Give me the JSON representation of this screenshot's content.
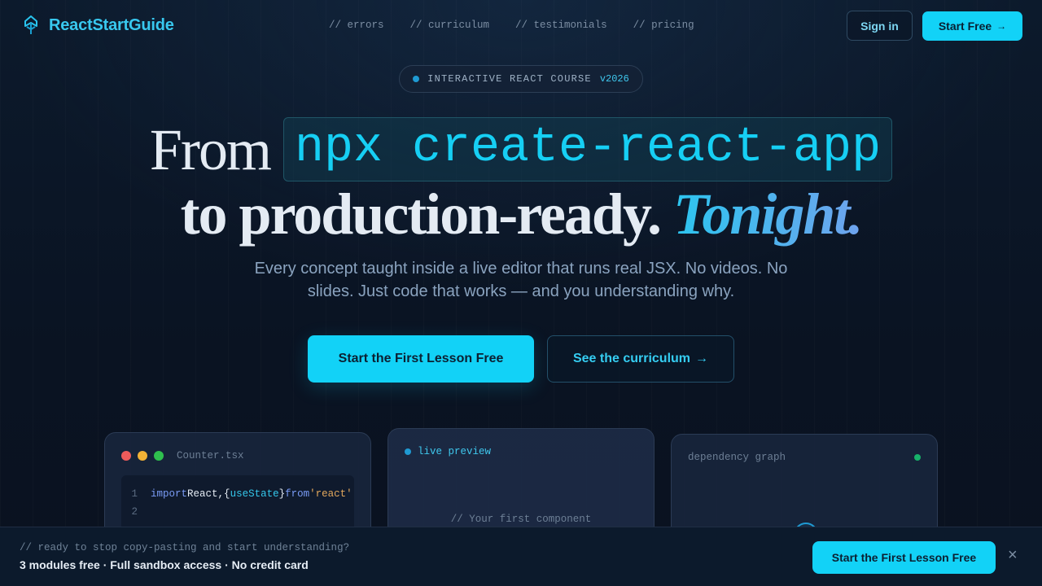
{
  "brand": {
    "name": "ReactStartGuide",
    "logo_icon": "react-tower-icon"
  },
  "nav": {
    "links": [
      "// errors",
      "// curriculum",
      "// testimonials",
      "// pricing"
    ],
    "sign_in": "Sign in",
    "start_free": "Start Free",
    "start_free_arrow": "→"
  },
  "badge": {
    "text": "INTERACTIVE REACT COURSE",
    "version": "v2026"
  },
  "hero": {
    "line1_prefix": "From",
    "line1_code": "npx create-react-app",
    "line2_text": "to production-ready.",
    "line2_accent": "Tonight.",
    "subhead": "Every concept taught inside a live editor that runs real JSX. No videos. No slides. Just code that works — and you understanding why.",
    "cta_primary": "Start the First Lesson Free",
    "cta_secondary": "See the curriculum",
    "cta_secondary_arrow": "→"
  },
  "cards": {
    "editor": {
      "filename": "Counter.tsx",
      "line1_num": "1",
      "line1_tokens": {
        "kw1": "import",
        "id1": "React",
        "p1": ",",
        "p2": "{",
        "fn1": "useState",
        "p3": "}",
        "kw2": "from",
        "str1": "'react'"
      },
      "line2_num": "2"
    },
    "preview": {
      "label": "live preview",
      "comment": "// Your first component"
    },
    "graph": {
      "label": "dependency graph"
    }
  },
  "bottom_bar": {
    "comment": "// ready to stop copy-pasting and start understanding?",
    "main": "3 modules free · Full sandbox access · No credit card",
    "cta": "Start the First Lesson Free",
    "close": "×"
  },
  "colors": {
    "accent": "#12d2f7",
    "brand_text": "#38c8ef",
    "background": "#0b1426"
  }
}
